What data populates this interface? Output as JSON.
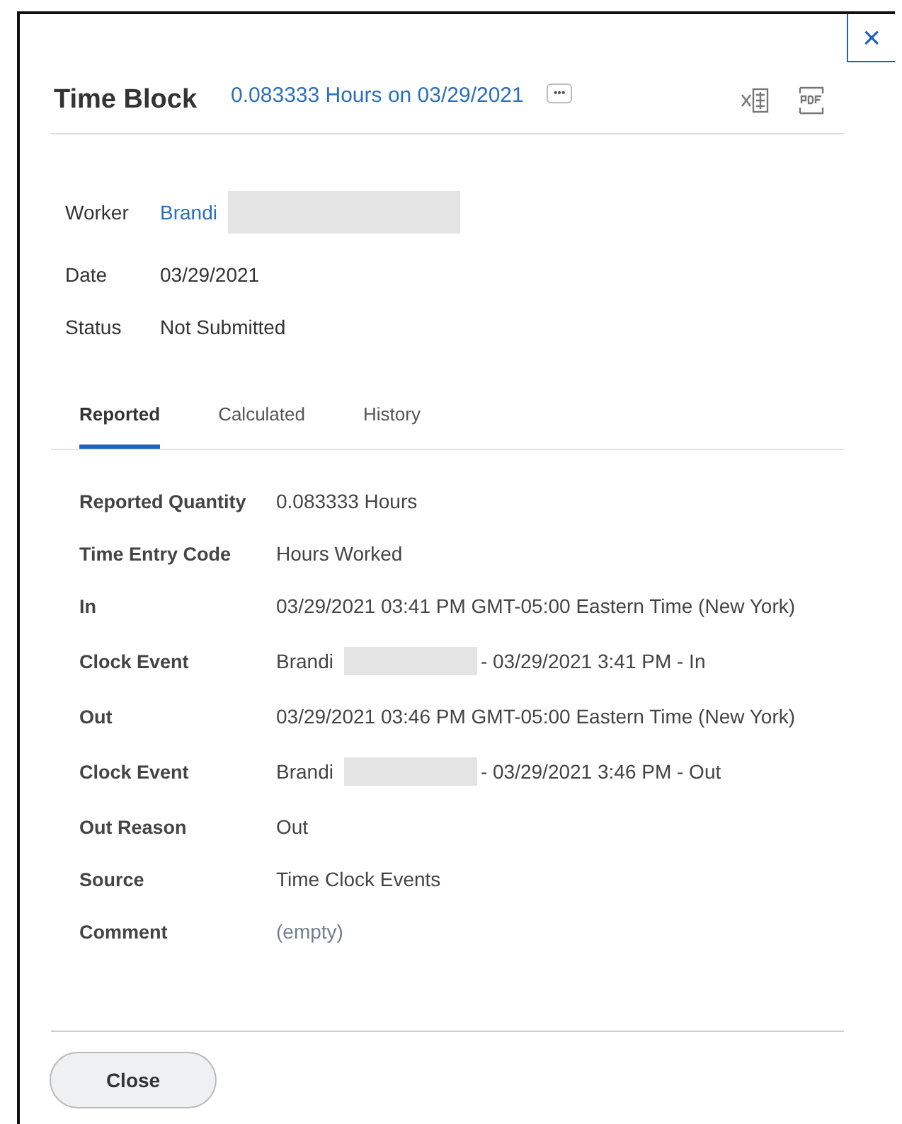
{
  "dialog": {
    "title": "Time Block",
    "subtitle_link": "0.083333 Hours on 03/29/2021",
    "more_button": "•••",
    "close_icon": "×"
  },
  "summary": [
    {
      "label": "Worker",
      "value": "Brandi",
      "link": true,
      "redacted": true
    },
    {
      "label": "Date",
      "value": "03/29/2021",
      "link": false,
      "redacted": false
    },
    {
      "label": "Status",
      "value": "Not Submitted",
      "link": false,
      "redacted": false
    }
  ],
  "tabs": [
    {
      "label": "Reported",
      "selected": true
    },
    {
      "label": "Calculated",
      "selected": false
    },
    {
      "label": "History",
      "selected": false
    }
  ],
  "details": [
    {
      "label": "Reported Quantity",
      "value": "0.083333 Hours",
      "muted": false
    },
    {
      "label": "Time Entry Code",
      "value": "Hours Worked",
      "muted": false
    },
    {
      "label": "In",
      "value": "03/29/2021 03:41 PM GMT-05:00 Eastern Time (New York)",
      "muted": false
    },
    {
      "label": "Clock Event",
      "value": "Brandi",
      "redacted": true,
      "after": "- 03/29/2021 3:41 PM - In",
      "muted": false
    },
    {
      "label": "Out",
      "value": "03/29/2021 03:46 PM GMT-05:00 Eastern Time (New York)",
      "muted": false
    },
    {
      "label": "Clock Event",
      "value": "Brandi",
      "redacted": true,
      "after": "- 03/29/2021 3:46 PM - Out",
      "muted": false
    },
    {
      "label": "Out Reason",
      "value": "Out",
      "muted": false
    },
    {
      "label": "Source",
      "value": "Time Clock Events",
      "muted": false
    },
    {
      "label": "Comment",
      "value": "(empty)",
      "muted": true
    }
  ],
  "footer": {
    "button": "Close"
  }
}
